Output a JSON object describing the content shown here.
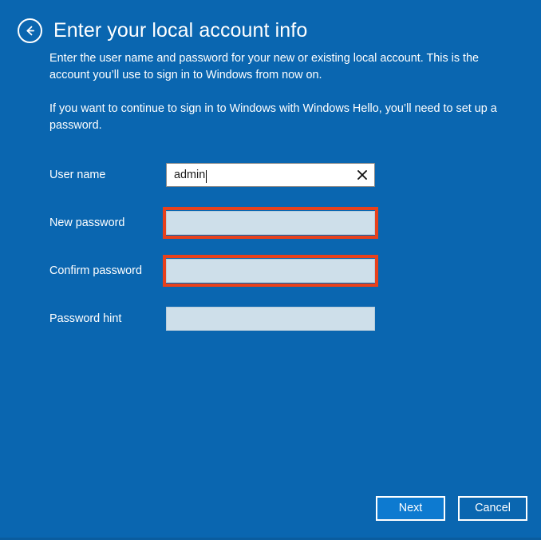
{
  "theme": {
    "background": "#0a66b0",
    "accent_button": "#0d7ad0",
    "highlight": "#e8411c",
    "disabled_field": "#cedfea",
    "text": "#ffffff"
  },
  "header": {
    "back_icon": "back-arrow-circle-icon",
    "title": "Enter your local account info"
  },
  "description": {
    "paragraph1": "Enter the user name and password for your new or existing local account. This is the account you’ll use to sign in to Windows from now on.",
    "paragraph2": "If you want to continue to sign in to Windows with Windows Hello, you’ll need to set up a password."
  },
  "form": {
    "fields": [
      {
        "label": "User name",
        "value": "admin",
        "placeholder": "",
        "state": "active",
        "has_clear_icon": true,
        "clear_icon": "close-x-icon",
        "highlighted": false
      },
      {
        "label": "New password",
        "value": "",
        "placeholder": "",
        "state": "empty",
        "has_clear_icon": false,
        "clear_icon": "",
        "highlighted": true
      },
      {
        "label": "Confirm password",
        "value": "",
        "placeholder": "",
        "state": "empty",
        "has_clear_icon": false,
        "clear_icon": "",
        "highlighted": true
      },
      {
        "label": "Password hint",
        "value": "",
        "placeholder": "",
        "state": "empty",
        "has_clear_icon": false,
        "clear_icon": "",
        "highlighted": false
      }
    ]
  },
  "footer": {
    "next_label": "Next",
    "cancel_label": "Cancel"
  }
}
